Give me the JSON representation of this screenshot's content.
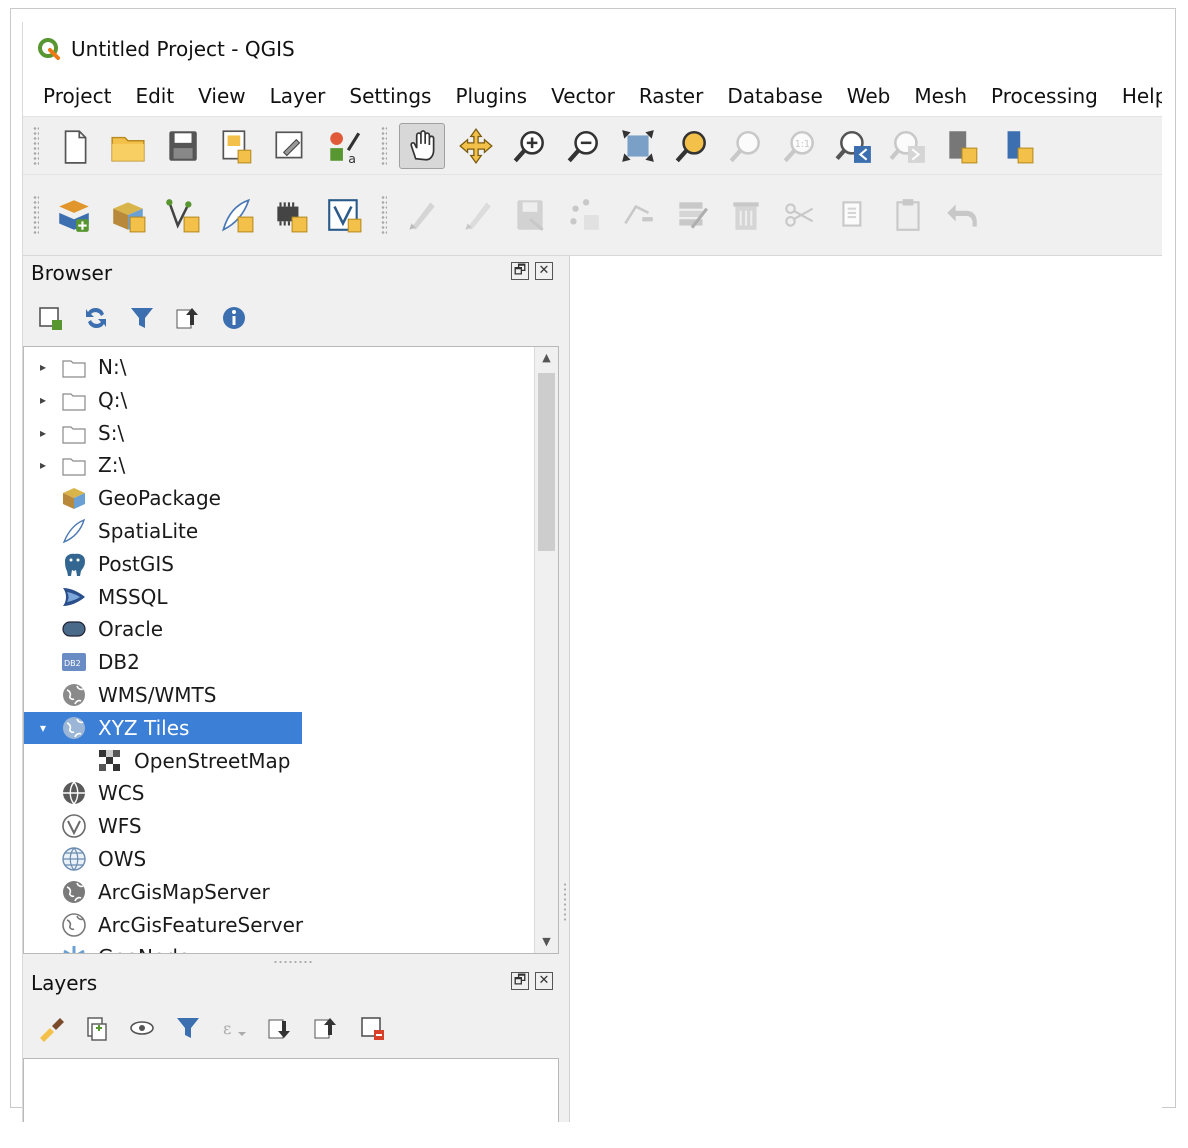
{
  "window": {
    "title": "Untitled Project - QGIS"
  },
  "menu": [
    "Project",
    "Edit",
    "View",
    "Layer",
    "Settings",
    "Plugins",
    "Vector",
    "Raster",
    "Database",
    "Web",
    "Mesh",
    "Processing",
    "Help"
  ],
  "toolbar_primary": [
    {
      "name": "new-project-icon"
    },
    {
      "name": "open-project-icon"
    },
    {
      "name": "save-project-icon"
    },
    {
      "name": "new-print-layout-icon"
    },
    {
      "name": "layout-manager-icon"
    },
    {
      "name": "style-manager-icon"
    },
    {
      "name": "pan-map-icon",
      "active": true
    },
    {
      "name": "pan-to-selection-icon"
    },
    {
      "name": "zoom-in-icon"
    },
    {
      "name": "zoom-out-icon"
    },
    {
      "name": "zoom-full-icon"
    },
    {
      "name": "zoom-to-selection-icon"
    },
    {
      "name": "zoom-to-layer-icon",
      "disabled": true
    },
    {
      "name": "zoom-native-resolution-icon",
      "disabled": true
    },
    {
      "name": "zoom-last-icon"
    },
    {
      "name": "zoom-next-icon",
      "disabled": true
    },
    {
      "name": "new-map-view-icon"
    },
    {
      "name": "new-3d-map-view-icon"
    }
  ],
  "toolbar_secondary": [
    {
      "name": "data-source-manager-icon"
    },
    {
      "name": "new-geopackage-layer-icon"
    },
    {
      "name": "new-shapefile-layer-icon"
    },
    {
      "name": "new-spatialite-layer-icon"
    },
    {
      "name": "new-temporary-layer-icon"
    },
    {
      "name": "new-virtual-layer-icon"
    },
    {
      "name": "current-edits-icon",
      "disabled": true
    },
    {
      "name": "toggle-editing-icon",
      "disabled": true
    },
    {
      "name": "save-layer-edits-icon",
      "disabled": true
    },
    {
      "name": "add-point-feature-icon",
      "disabled": true
    },
    {
      "name": "vertex-tool-icon",
      "disabled": true
    },
    {
      "name": "modify-attributes-icon",
      "disabled": true
    },
    {
      "name": "delete-selected-icon",
      "disabled": true
    },
    {
      "name": "cut-features-icon",
      "disabled": true
    },
    {
      "name": "copy-features-icon",
      "disabled": true
    },
    {
      "name": "paste-features-icon",
      "disabled": true
    },
    {
      "name": "undo-icon",
      "disabled": true
    }
  ],
  "browser": {
    "title": "Browser",
    "float_glyph": "🗗",
    "close_glyph": "✕",
    "tools": [
      "add-selected-layers-icon",
      "refresh-icon",
      "filter-icon",
      "collapse-all-icon",
      "properties-icon"
    ],
    "items": [
      {
        "label": "N:\\",
        "icon": "folder-icon",
        "arrow": "▸",
        "indent": 0
      },
      {
        "label": "Q:\\",
        "icon": "folder-icon",
        "arrow": "▸",
        "indent": 0
      },
      {
        "label": "S:\\",
        "icon": "folder-icon",
        "arrow": "▸",
        "indent": 0
      },
      {
        "label": "Z:\\",
        "icon": "folder-icon",
        "arrow": "▸",
        "indent": 0
      },
      {
        "label": "GeoPackage",
        "icon": "geopackage-icon",
        "arrow": "",
        "indent": 0
      },
      {
        "label": "SpatiaLite",
        "icon": "spatialite-icon",
        "arrow": "",
        "indent": 0
      },
      {
        "label": "PostGIS",
        "icon": "postgis-icon",
        "arrow": "",
        "indent": 0
      },
      {
        "label": "MSSQL",
        "icon": "mssql-icon",
        "arrow": "",
        "indent": 0
      },
      {
        "label": "Oracle",
        "icon": "oracle-icon",
        "arrow": "",
        "indent": 0
      },
      {
        "label": "DB2",
        "icon": "db2-icon",
        "arrow": "",
        "indent": 0
      },
      {
        "label": "WMS/WMTS",
        "icon": "wms-icon",
        "arrow": "",
        "indent": 0
      },
      {
        "label": "XYZ Tiles",
        "icon": "xyz-tiles-icon",
        "arrow": "▾",
        "indent": 0,
        "selected": true
      },
      {
        "label": "OpenStreetMap",
        "icon": "openstreetmap-icon",
        "arrow": "",
        "indent": 1
      },
      {
        "label": "WCS",
        "icon": "wcs-icon",
        "arrow": "",
        "indent": 0
      },
      {
        "label": "WFS",
        "icon": "wfs-icon",
        "arrow": "",
        "indent": 0
      },
      {
        "label": "OWS",
        "icon": "ows-icon",
        "arrow": "",
        "indent": 0
      },
      {
        "label": "ArcGisMapServer",
        "icon": "arcgis-map-server-icon",
        "arrow": "",
        "indent": 0
      },
      {
        "label": "ArcGisFeatureServer",
        "icon": "arcgis-feature-server-icon",
        "arrow": "",
        "indent": 0
      },
      {
        "label": "GeoNode",
        "icon": "geonode-icon",
        "arrow": "",
        "indent": 0
      }
    ]
  },
  "layers": {
    "title": "Layers",
    "float_glyph": "🗗",
    "close_glyph": "✕",
    "tools": [
      "open-layer-styling-icon",
      "add-group-icon",
      "manage-map-themes-icon",
      "filter-legend-icon",
      "filter-by-expression-icon",
      "expand-all-icon",
      "collapse-all-icon",
      "remove-layer-icon"
    ]
  },
  "colors": {
    "selection": "#3c7fd6",
    "qgis_green": "#589632",
    "folder_yellow": "#f3c04a"
  }
}
